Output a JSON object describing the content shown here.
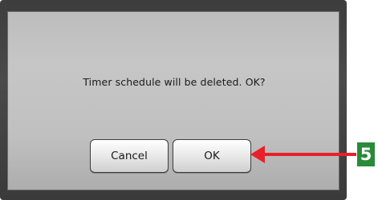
{
  "dialog": {
    "message": "Timer schedule will be deleted. OK?",
    "cancel_label": "Cancel",
    "ok_label": "OK"
  },
  "annotation": {
    "step_number": "5",
    "arrow_color": "#e8202a",
    "badge_color": "#2a8a3a"
  }
}
